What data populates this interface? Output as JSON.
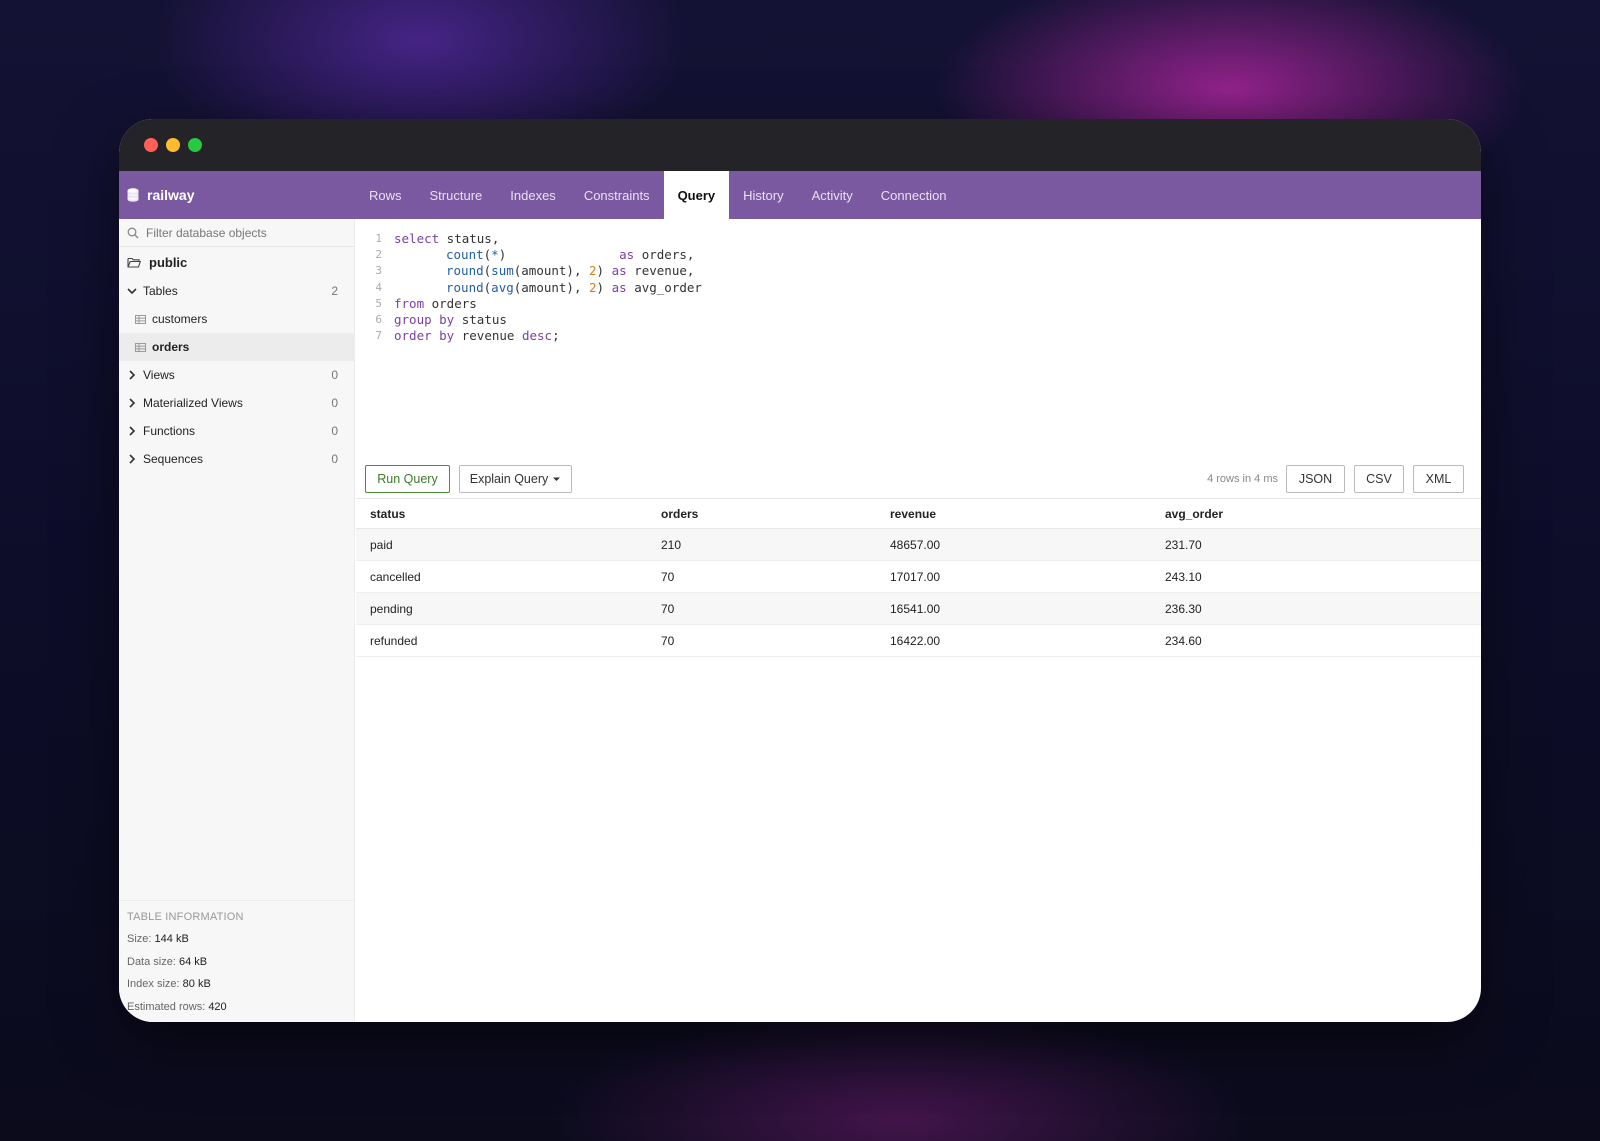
{
  "app": {
    "db_name": "railway"
  },
  "tabs": [
    {
      "label": "Rows"
    },
    {
      "label": "Structure"
    },
    {
      "label": "Indexes"
    },
    {
      "label": "Constraints"
    },
    {
      "label": "Query",
      "active": true
    },
    {
      "label": "History"
    },
    {
      "label": "Activity"
    },
    {
      "label": "Connection"
    }
  ],
  "sidebar": {
    "filter_placeholder": "Filter database objects",
    "schema": "public",
    "groups": {
      "tables": {
        "label": "Tables",
        "count": "2",
        "expanded": true
      },
      "views": {
        "label": "Views",
        "count": "0"
      },
      "matviews": {
        "label": "Materialized Views",
        "count": "0"
      },
      "functions": {
        "label": "Functions",
        "count": "0"
      },
      "sequences": {
        "label": "Sequences",
        "count": "0"
      }
    },
    "tables": [
      {
        "name": "customers"
      },
      {
        "name": "orders",
        "selected": true
      }
    ],
    "table_info": {
      "header": "TABLE INFORMATION",
      "size_label": "Size:",
      "size": "144 kB",
      "data_size_label": "Data size:",
      "data_size": "64 kB",
      "index_size_label": "Index size:",
      "index_size": "80 kB",
      "est_rows_label": "Estimated rows:",
      "est_rows": "420"
    }
  },
  "editor": {
    "line_numbers": [
      "1",
      "2",
      "3",
      "4",
      "5",
      "6",
      "7"
    ],
    "l1": {
      "kw": "select",
      "rest": " status,"
    },
    "l2": {
      "fn": "count",
      "p1": "(",
      "star": "*",
      "p2": ")",
      "pad": "               ",
      "kw": "as",
      "rest": " orders,"
    },
    "l3": {
      "fn": "round",
      "p1": "(",
      "fn2": "sum",
      "mid": "(amount), ",
      "num": "2",
      "close": ") ",
      "kw": "as",
      "rest": " revenue,"
    },
    "l4": {
      "fn": "round",
      "p1": "(",
      "fn2": "avg",
      "mid": "(amount), ",
      "num": "2",
      "close": ") ",
      "kw": "as",
      "rest": " avg_order"
    },
    "l5": {
      "kw": "from",
      "rest": " orders"
    },
    "l6": {
      "kw": "group by",
      "rest": " status"
    },
    "l7": {
      "kw": "order by",
      "mid": " revenue ",
      "kw2": "desc",
      "rest": ";"
    }
  },
  "toolbar": {
    "run_label": "Run Query",
    "explain_label": "Explain Query",
    "row_info": "4 rows in 4 ms",
    "json_label": "JSON",
    "csv_label": "CSV",
    "xml_label": "XML"
  },
  "results": {
    "columns": [
      "status",
      "orders",
      "revenue",
      "avg_order"
    ],
    "rows": [
      [
        "paid",
        "210",
        "48657.00",
        "231.70"
      ],
      [
        "cancelled",
        "70",
        "17017.00",
        "243.10"
      ],
      [
        "pending",
        "70",
        "16541.00",
        "236.30"
      ],
      [
        "refunded",
        "70",
        "16422.00",
        "234.60"
      ]
    ]
  },
  "colors": {
    "topbar": "#7b59a1",
    "keyword": "#7b3fa6",
    "function": "#1f5fa5",
    "number": "#d8801a",
    "run_button": "#3c7a2a"
  }
}
